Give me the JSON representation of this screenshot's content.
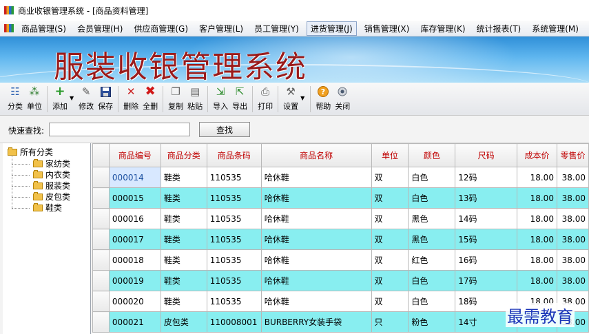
{
  "window": {
    "title": "商业收银管理系统 - [商品资料管理]"
  },
  "menu": [
    {
      "label": "商品管理(S)"
    },
    {
      "label": "会员管理(H)"
    },
    {
      "label": "供应商管理(G)"
    },
    {
      "label": "客户管理(L)"
    },
    {
      "label": "员工管理(Y)"
    },
    {
      "label": "进货管理(J)"
    },
    {
      "label": "销售管理(X)"
    },
    {
      "label": "库存管理(K)"
    },
    {
      "label": "统计报表(T)"
    },
    {
      "label": "系统管理(M)"
    }
  ],
  "banner": {
    "title": "服装收银管理系统"
  },
  "toolbar": {
    "category": "分类",
    "unit": "单位",
    "add": "添加",
    "edit": "修改",
    "save": "保存",
    "delete": "删除",
    "delete_all": "全删",
    "copy": "复制",
    "paste": "粘贴",
    "import": "导入",
    "export": "导出",
    "print": "打印",
    "settings": "设置",
    "help": "帮助",
    "close": "关闭"
  },
  "search": {
    "label": "快速查找:",
    "value": "",
    "button": "查找"
  },
  "tree": {
    "root": "所有分类",
    "children": [
      "家纺类",
      "内衣类",
      "服装类",
      "皮包类",
      "鞋类"
    ]
  },
  "grid": {
    "headers": [
      "商品编号",
      "商品分类",
      "商品条码",
      "商品名称",
      "单位",
      "颜色",
      "尺码",
      "成本价",
      "零售价"
    ],
    "rows": [
      [
        "000014",
        "鞋类",
        "110535",
        "哈休鞋",
        "双",
        "白色",
        "12码",
        "18.00",
        "38.00"
      ],
      [
        "000015",
        "鞋类",
        "110535",
        "哈休鞋",
        "双",
        "白色",
        "13码",
        "18.00",
        "38.00"
      ],
      [
        "000016",
        "鞋类",
        "110535",
        "哈休鞋",
        "双",
        "黑色",
        "14码",
        "18.00",
        "38.00"
      ],
      [
        "000017",
        "鞋类",
        "110535",
        "哈休鞋",
        "双",
        "黑色",
        "15码",
        "18.00",
        "38.00"
      ],
      [
        "000018",
        "鞋类",
        "110535",
        "哈休鞋",
        "双",
        "红色",
        "16码",
        "18.00",
        "38.00"
      ],
      [
        "000019",
        "鞋类",
        "110535",
        "哈休鞋",
        "双",
        "白色",
        "17码",
        "18.00",
        "38.00"
      ],
      [
        "000020",
        "鞋类",
        "110535",
        "哈休鞋",
        "双",
        "白色",
        "18码",
        "18.00",
        "38.00"
      ],
      [
        "000021",
        "皮包类",
        "110008001",
        "BURBERRY女装手袋",
        "只",
        "粉色",
        "14寸",
        "",
        "38.00"
      ]
    ]
  },
  "watermark": "最需教育",
  "colors": {
    "header_text": "#c00000",
    "row_alt": "#88eef0",
    "banner_title": "#9a1b1b"
  }
}
